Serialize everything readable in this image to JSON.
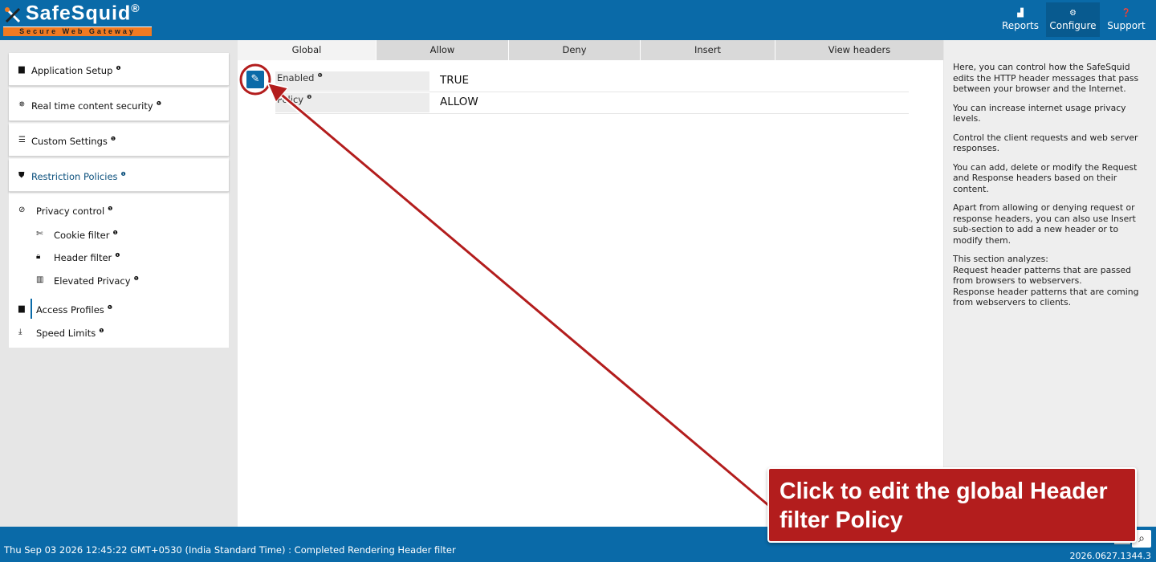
{
  "brand": {
    "name": "SafeSquid",
    "reg": "®",
    "tagline": "Secure Web Gateway"
  },
  "topnav": [
    {
      "label": "Reports",
      "icon": "chart-icon"
    },
    {
      "label": "Configure",
      "icon": "gears-icon",
      "active": true
    },
    {
      "label": "Support",
      "icon": "question-icon"
    }
  ],
  "sidebar": {
    "sections": [
      {
        "label": "Application Setup",
        "icon": "briefcase-icon"
      },
      {
        "label": "Real time content security",
        "icon": "bug-icon"
      },
      {
        "label": "Custom Settings",
        "icon": "sliders-icon"
      },
      {
        "label": "Restriction Policies",
        "icon": "shield-icon",
        "active": true
      }
    ],
    "items": [
      {
        "label": "Privacy control",
        "icon": "ban-icon"
      },
      {
        "label": "Cookie filter",
        "icon": "scissors-icon"
      },
      {
        "label": "Header filter",
        "icon": "lock-icon",
        "active": true
      },
      {
        "label": "Elevated Privacy",
        "icon": "barcode-icon"
      },
      {
        "label": "Access Profiles",
        "icon": "briefcase-icon"
      },
      {
        "label": "Speed Limits",
        "icon": "download-icon"
      }
    ]
  },
  "tabs": [
    "Global",
    "Allow",
    "Deny",
    "Insert",
    "View headers"
  ],
  "active_tab": "Global",
  "fields": [
    {
      "key": "Enabled",
      "value": "TRUE"
    },
    {
      "key": "Policy",
      "value": "ALLOW"
    }
  ],
  "help": {
    "p1": "Here, you can control how the SafeSquid edits the HTTP header messages that pass between your browser and the Internet.",
    "p2": "You can increase internet usage privacy levels.",
    "p3": "Control the client requests and web server responses.",
    "p4": "You can add, delete or modify the Request and Response headers based on their content.",
    "p5": "Apart from allowing or denying request or response headers, you can also use Insert sub-section to add a new header or to modify them.",
    "p6_line1": "This section analyzes:",
    "p6_line2": "Request header patterns that are passed from browsers to webservers.",
    "p6_line3": "Response header patterns that are coming from webservers to clients."
  },
  "footer": {
    "status": "Thu Sep 03 2026 12:45:22 GMT+0530 (India Standard Time) : Completed Rendering Header filter",
    "version": "2026.0627.1344.3"
  },
  "callout": {
    "text": "Click to edit the global Header filter Policy"
  },
  "colors": {
    "brand_blue": "#0a6aa8",
    "accent_orange": "#f07a22",
    "callout_red": "#b31d1d"
  }
}
